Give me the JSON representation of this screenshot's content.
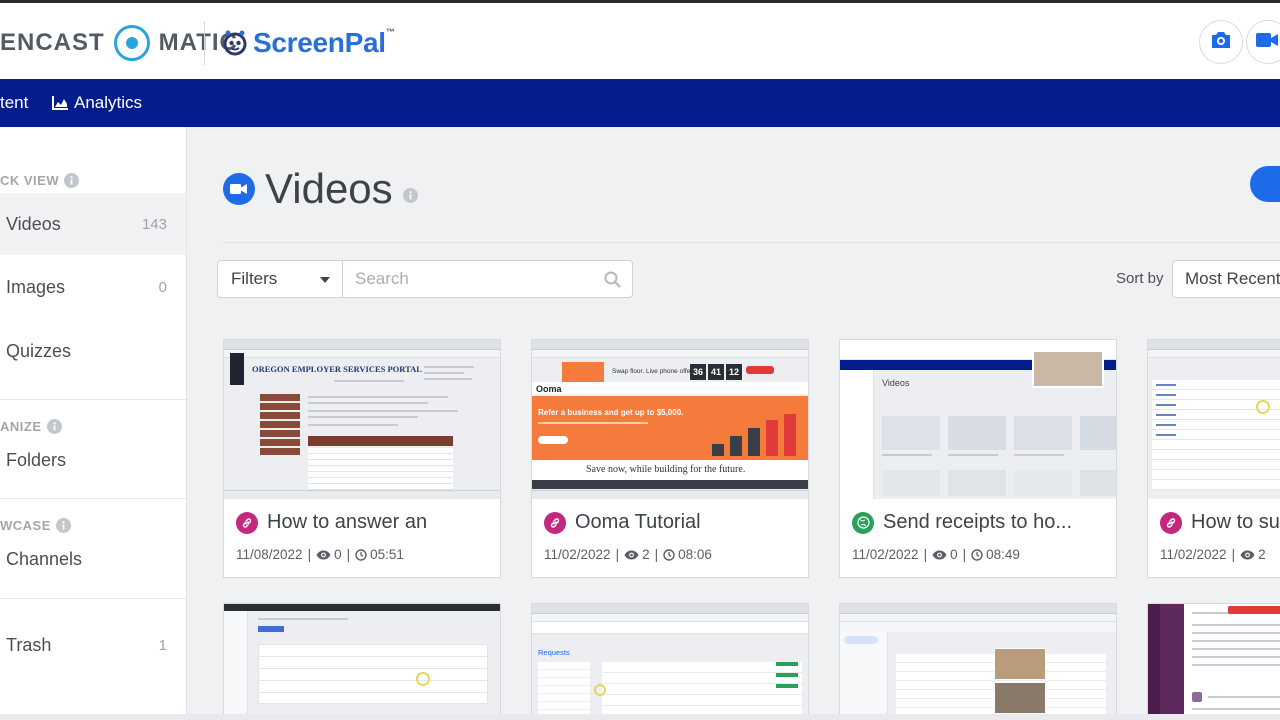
{
  "header": {
    "logo_left_a": "ENCAST",
    "logo_left_b": "MATIC",
    "logo_right": "ScreenPal",
    "logo_tm": "™"
  },
  "nav": {
    "items": [
      {
        "label": "tent"
      },
      {
        "label": "Analytics"
      }
    ]
  },
  "sidebar": {
    "headings": [
      "CK VIEW",
      "ANIZE",
      "WCASE"
    ],
    "items": [
      {
        "label": "Videos",
        "count": "143"
      },
      {
        "label": "Images",
        "count": "0"
      },
      {
        "label": "Quizzes",
        "count": ""
      },
      {
        "label": "Folders",
        "count": ""
      },
      {
        "label": "Channels",
        "count": ""
      },
      {
        "label": "Trash",
        "count": "1"
      }
    ]
  },
  "main": {
    "title": "Videos",
    "filters_label": "Filters",
    "search_placeholder": "Search",
    "sort_by_label": "Sort by",
    "sort_value": "Most Recent"
  },
  "cards": [
    {
      "title": "How to answer an",
      "date": "11/08/2022",
      "views": "0",
      "duration": "05:51",
      "status": "link"
    },
    {
      "title": "Ooma Tutorial",
      "date": "11/02/2022",
      "views": "2",
      "duration": "08:06",
      "status": "link"
    },
    {
      "title": "Send receipts to ho...",
      "date": "11/02/2022",
      "views": "0",
      "duration": "08:49",
      "status": "public"
    },
    {
      "title": "How to su",
      "date": "11/02/2022",
      "views": "2",
      "duration": "",
      "status": "link"
    }
  ],
  "thumbs": {
    "oregon_title": "OREGON EMPLOYER SERVICES PORTAL",
    "ooma_brand": "Ooma",
    "ooma_promo": "Swap floor. Live phone offer!",
    "ooma_t1": "36",
    "ooma_t2": "41",
    "ooma_t3": "12",
    "ooma_headline": "Refer a business and get up to $5,000.",
    "ooma_caption": "Save now, while building for the future.",
    "sp_thumb_title": "Videos",
    "requests_label": "Requests"
  },
  "colors": {
    "nav_bg": "#041c8c",
    "accent": "#1d6be8",
    "status_link": "#c2297e",
    "status_public": "#2aa05a",
    "ooma_orange": "#f47b3b"
  }
}
